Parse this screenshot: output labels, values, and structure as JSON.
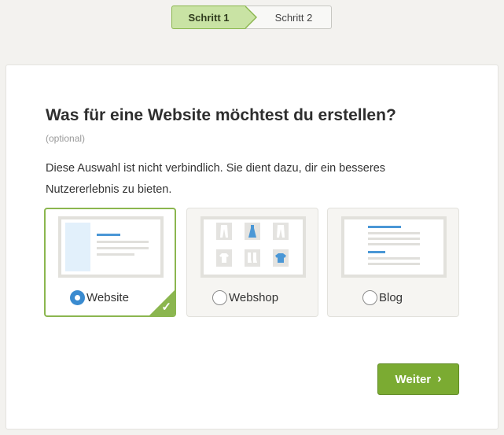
{
  "stepper": {
    "steps": [
      {
        "label": "Schritt 1"
      },
      {
        "label": "Schritt 2"
      }
    ]
  },
  "main": {
    "title": "Was für eine Website möchtest du erstellen?",
    "subtitle": "(optional)",
    "description": "Diese Auswahl ist nicht verbindlich. Sie dient dazu, dir ein besseres Nutzererlebnis zu bieten."
  },
  "options": [
    {
      "label": "Website",
      "selected": true
    },
    {
      "label": "Webshop",
      "selected": false
    },
    {
      "label": "Blog",
      "selected": false
    }
  ],
  "actions": {
    "next_label": "Weiter"
  },
  "colors": {
    "accent_green": "#7bab32",
    "radio_blue": "#3a8bd0",
    "step_active_bg": "#c9e3a4"
  }
}
